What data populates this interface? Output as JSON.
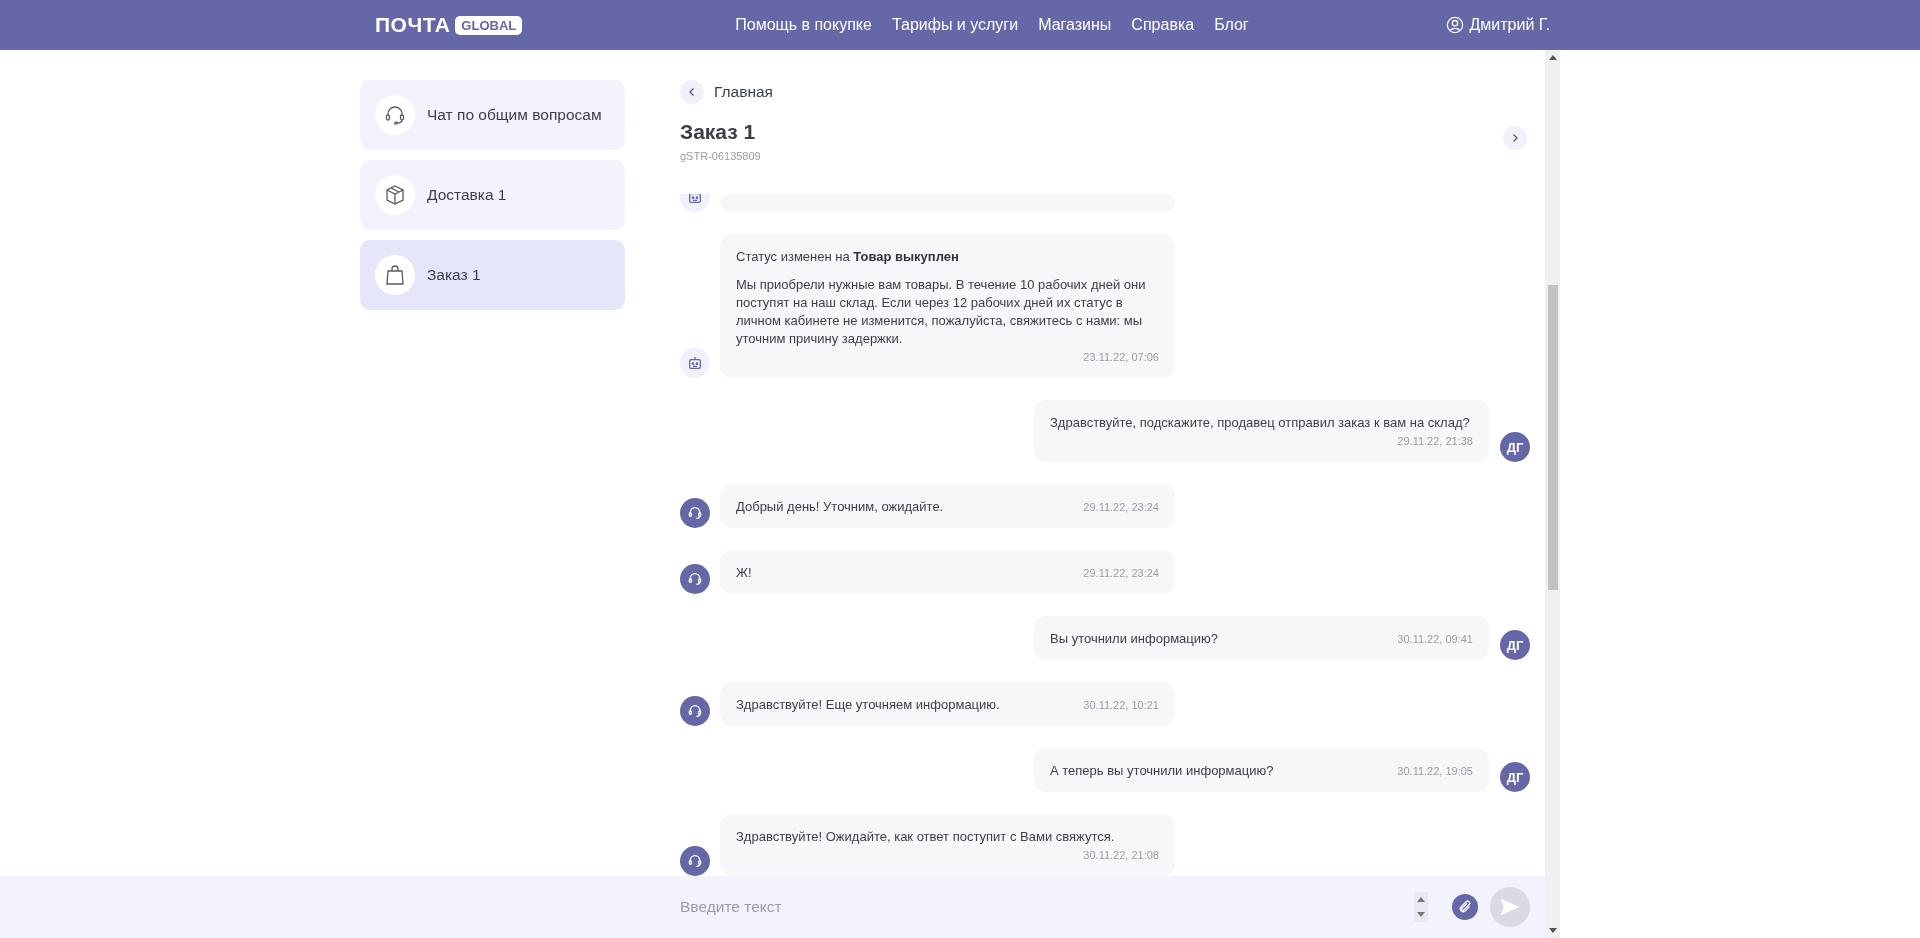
{
  "header": {
    "logo": "ПОЧТА",
    "logo_badge": "GLOBAL",
    "nav": [
      "Помощь в покупке",
      "Тарифы и услуги",
      "Магазины",
      "Справка",
      "Блог"
    ],
    "user": "Дмитрий Г."
  },
  "sidebar": {
    "items": [
      {
        "label": "Чат по общим вопросам",
        "kind": "support",
        "selected": false
      },
      {
        "label": "Доставка 1",
        "kind": "delivery",
        "selected": false
      },
      {
        "label": "Заказ 1",
        "kind": "order",
        "selected": true
      }
    ]
  },
  "chat": {
    "back": "Главная",
    "title": "Заказ 1",
    "code": "gSTR-06135809",
    "messages": [
      {
        "kind": "cut"
      },
      {
        "kind": "status",
        "status_line": "Статус изменен на **Товар выкуплен**",
        "text": "Мы приобрели нужные вам товары. В течение 10 рабочих дней они поступят на наш склад. Если через 12 рабочих дней их статус в личном кабинете не изменится, пожалуйста, свяжитесь с нами: мы уточним причину задержки.",
        "time": "23.11.22, 07:06"
      },
      {
        "kind": "user",
        "initials": "ДГ",
        "text": "Здравствуйте, подскажите, продавец отправил заказ к вам на склад?",
        "time": "29.11.22, 21:38"
      },
      {
        "kind": "operator",
        "text": "Добрый день! Уточним, ожидайте.",
        "time": "29.11.22, 23:24"
      },
      {
        "kind": "operator",
        "text": "Ж!",
        "time": "29.11.22, 23:24"
      },
      {
        "kind": "user",
        "initials": "ДГ",
        "text": "Вы уточнили информацию?",
        "time": "30.11.22, 09:41"
      },
      {
        "kind": "operator",
        "text": "Здравствуйте! Еще уточняем информацию.",
        "time": "30.11.22, 10:21"
      },
      {
        "kind": "user",
        "initials": "ДГ",
        "text": "А теперь вы уточнили информацию?",
        "time": "30.11.22, 19:05"
      },
      {
        "kind": "operator",
        "text": "Здравствуйте! Ожидайте, как ответ поступит с Вами свяжутся.",
        "time": "30.11.22, 21:08"
      }
    ],
    "input": {
      "placeholder": "Введите текст"
    }
  }
}
